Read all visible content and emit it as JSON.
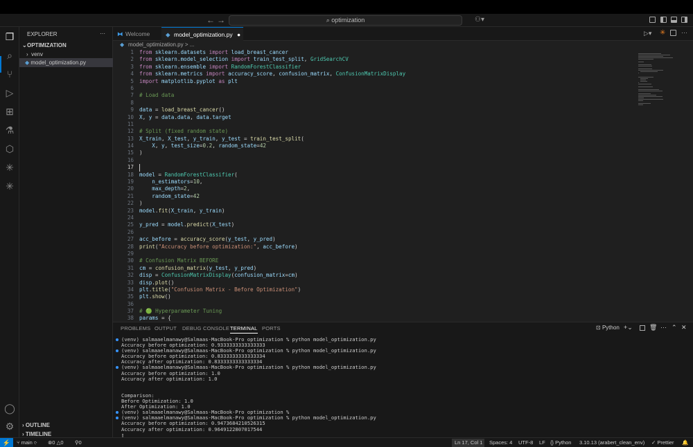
{
  "toolbar": {
    "search": "optimization"
  },
  "sidebar": {
    "header": "EXPLORER",
    "more": "···",
    "folder": "OPTIMIZATION",
    "items": [
      {
        "label": "venv",
        "kind": "folder"
      },
      {
        "label": "model_optimization.py",
        "kind": "file"
      }
    ],
    "outline": "OUTLINE",
    "timeline": "TIMELINE"
  },
  "tabs": [
    {
      "label": "Welcome"
    },
    {
      "label": "model_optimization.py",
      "modified": "●"
    }
  ],
  "breadcrumb": "model_optimization.py > ...",
  "editor": {
    "cursor_line": 17,
    "lines": [
      "from sklearn.datasets import load_breast_cancer",
      "from sklearn.model_selection import train_test_split, GridSearchCV",
      "from sklearn.ensemble import RandomForestClassifier",
      "from sklearn.metrics import accuracy_score, confusion_matrix, ConfusionMatrixDisplay",
      "import matplotlib.pyplot as plt",
      "",
      "# Load data",
      "",
      "data = load_breast_cancer()",
      "X, y = data.data, data.target",
      "",
      "# Split (fixed random state)",
      "X_train, X_test, y_train, y_test = train_test_split(",
      "    X, y, test_size=0.2, random_state=42",
      ")",
      "",
      "",
      "model = RandomForestClassifier(",
      "    n_estimators=10,",
      "    max_depth=2,",
      "    random_state=42",
      ")",
      "model.fit(X_train, y_train)",
      "",
      "y_pred = model.predict(X_test)",
      "",
      "acc_before = accuracy_score(y_test, y_pred)",
      "print(\"Accuracy before optimization:\", acc_before)",
      "",
      "# Confusion Matrix BEFORE",
      "cm = confusion_matrix(y_test, y_pred)",
      "disp = ConfusionMatrixDisplay(confusion_matrix=cm)",
      "disp.plot()",
      "plt.title(\"Confusion Matrix - Before Optimization\")",
      "plt.show()",
      "",
      "# 🟢 Hyperparameter Tuning",
      "params = {"
    ]
  },
  "panel": {
    "tabs": [
      "PROBLEMS",
      "OUTPUT",
      "DEBUG CONSOLE",
      "TERMINAL",
      "PORTS"
    ],
    "active_tab": "TERMINAL",
    "shell": "Python",
    "terminal": [
      {
        "text": "(venv) salmaaelmanawy@Salmaas-MacBook-Pro optimization % python model_optimization.py",
        "dot": true
      },
      {
        "text": "Accuracy before optimization: 0.9333333333333333",
        "dot": false
      },
      {
        "text": "(venv) salmaaelmanawy@Salmaas-MacBook-Pro optimization % python model_optimization.py",
        "dot": true
      },
      {
        "text": "Accuracy before optimization: 0.8333333333333334",
        "dot": false
      },
      {
        "text": "Accuracy after optimization: 0.8333333333333334",
        "dot": false
      },
      {
        "text": "(venv) salmaaelmanawy@Salmaas-MacBook-Pro optimization % python model_optimization.py",
        "dot": true
      },
      {
        "text": "Accuracy before optimization: 1.0",
        "dot": false
      },
      {
        "text": "Accuracy after optimization: 1.0",
        "dot": false
      },
      {
        "text": "",
        "dot": false
      },
      {
        "text": "",
        "dot": false
      },
      {
        "text": "Comparison:",
        "dot": false
      },
      {
        "text": "Before Optimization: 1.0",
        "dot": false
      },
      {
        "text": "After Optimization: 1.0",
        "dot": false
      },
      {
        "text": "(venv) salmaaelmanawy@Salmaas-MacBook-Pro optimization %",
        "dot": true
      },
      {
        "text": "(venv) salmaaelmanawy@Salmaas-MacBook-Pro optimization % python model_optimization.py",
        "dot": true
      },
      {
        "text": "Accuracy before optimization: 0.9473684210526315",
        "dot": false
      },
      {
        "text": "Accuracy after optimization: 0.9649122807017544",
        "dot": false
      },
      {
        "text": "▯",
        "dot": false
      }
    ]
  },
  "statusbar": {
    "remote": "⚡",
    "branch": "main",
    "errors": "0",
    "warnings": "0",
    "ports": "0",
    "position": "Ln 17, Col 1",
    "spaces": "Spaces: 4",
    "encoding": "UTF-8",
    "eol": "LF",
    "language": "Python",
    "interpreter": "3.10.13 (arabert_clean_env)",
    "prettier": "Prettier"
  },
  "colors": {
    "accent": "#0078d4",
    "editor_bg": "#1f1f1f",
    "sidebar_bg": "#181818"
  }
}
